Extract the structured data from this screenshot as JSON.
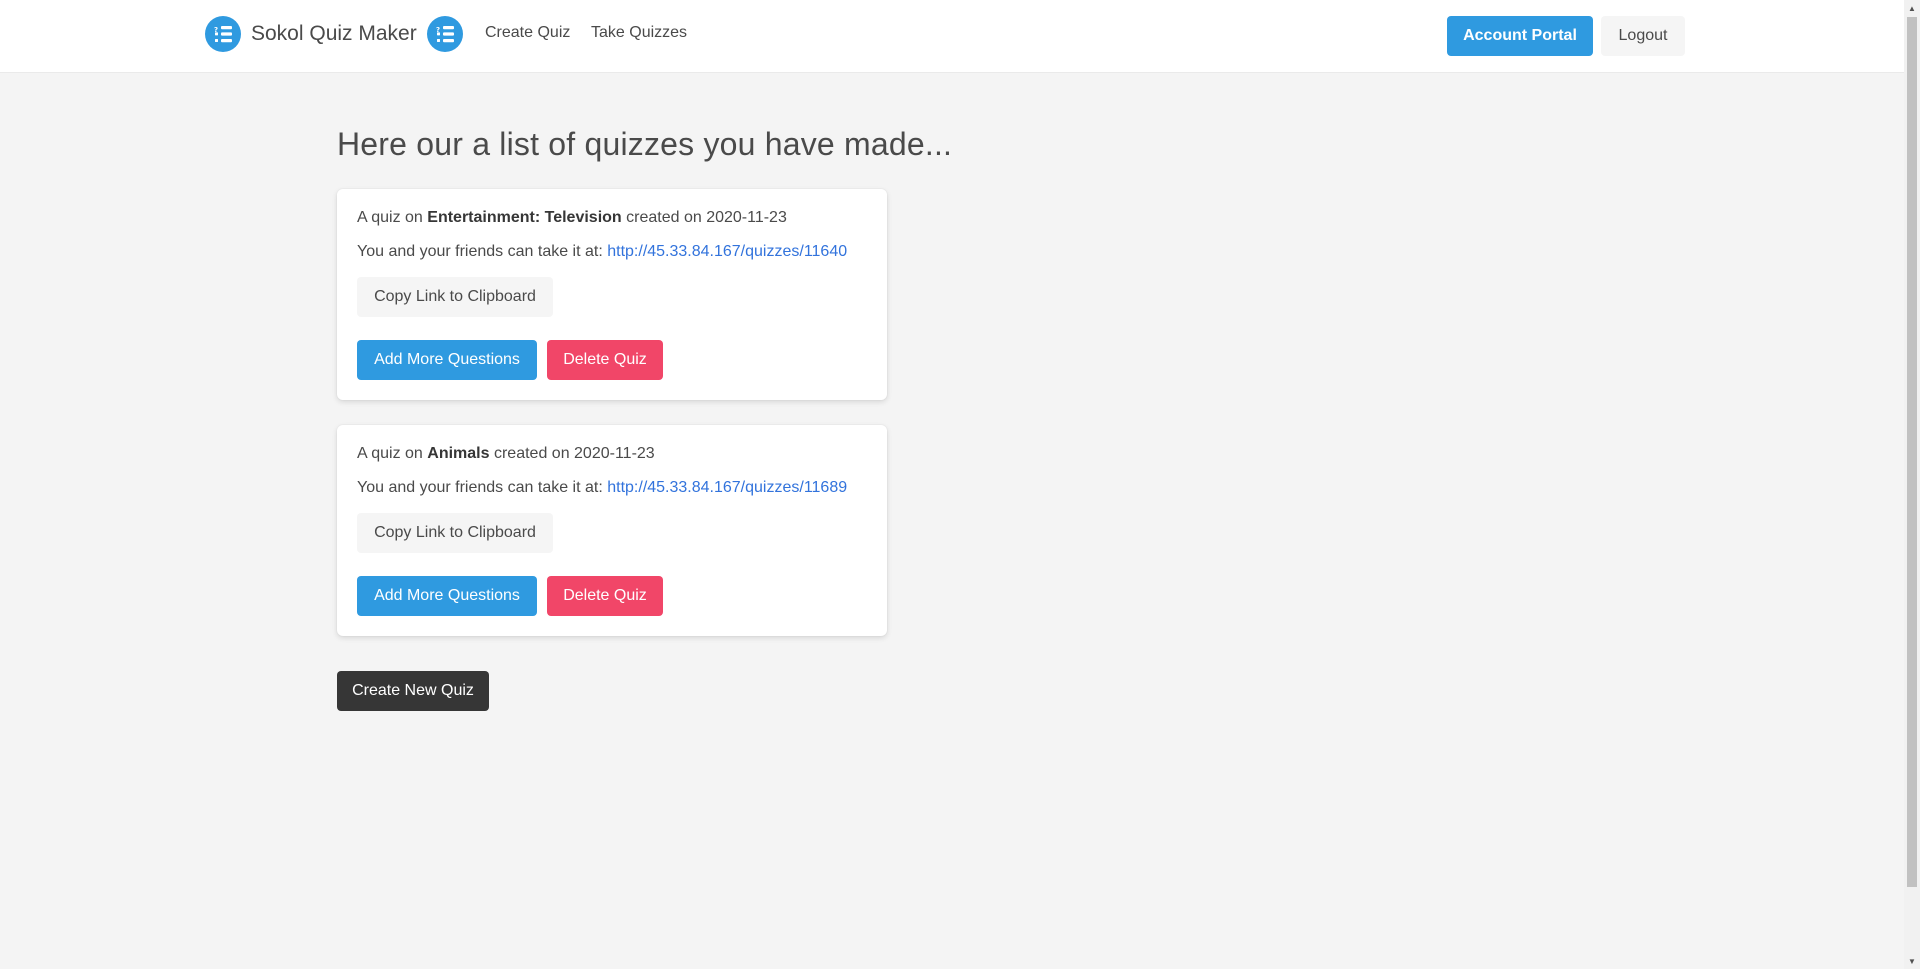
{
  "navbar": {
    "brand_title": "Sokol Quiz Maker",
    "links": [
      {
        "label": "Create Quiz"
      },
      {
        "label": "Take Quizzes"
      }
    ],
    "account_label": "Account Portal",
    "logout_label": "Logout"
  },
  "main": {
    "title": "Here our a list of quizzes you have made...",
    "quizzes": [
      {
        "prefix": "A quiz on ",
        "category": "Entertainment: Television",
        "created_text": " created on 2020-11-23",
        "share_text": "You and your friends can take it at: ",
        "link": "http://45.33.84.167/quizzes/11640",
        "copy_label": "Copy Link to Clipboard",
        "add_label": "Add More Questions",
        "delete_label": "Delete Quiz"
      },
      {
        "prefix": "A quiz on ",
        "category": "Animals",
        "created_text": " created on 2020-11-23",
        "share_text": "You and your friends can take it at: ",
        "link": "http://45.33.84.167/quizzes/11689",
        "copy_label": "Copy Link to Clipboard",
        "add_label": "Add More Questions",
        "delete_label": "Delete Quiz"
      }
    ],
    "create_new_label": "Create New Quiz"
  },
  "colors": {
    "primary": "#2f9ae0",
    "danger": "#f14668",
    "dark": "#363636",
    "link": "#3273dc",
    "background": "#f4f4f4"
  },
  "icons": {
    "logo": "quiz-list-icon"
  }
}
